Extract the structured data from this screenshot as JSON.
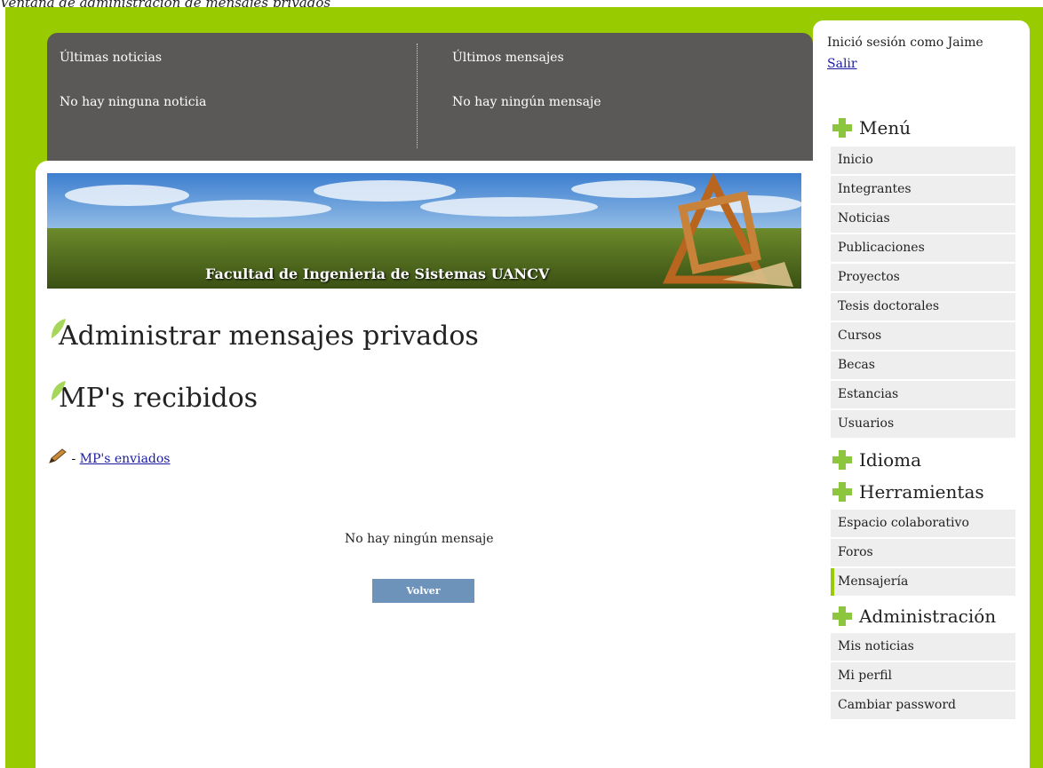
{
  "caption": "Ventana de administración de mensajes privados",
  "news": {
    "latest_news_title": "Últimas noticias",
    "latest_news_text": "No hay ninguna noticia",
    "latest_messages_title": "Últimos mensajes",
    "latest_messages_text": "No hay ningún mensaje"
  },
  "banner": {
    "title": "Facultad de Ingenieria de Sistemas UANCV"
  },
  "main": {
    "page_title": "Administrar mensajes privados",
    "section_title": "MP's recibidos",
    "sent_separator": "-",
    "sent_link": "MP's enviados",
    "empty_message": "No hay ningún mensaje",
    "back_button": "Volver"
  },
  "sidebar": {
    "login_text": "Inició sesión como Jaime",
    "logout_link": "Salir",
    "menu": {
      "title": "Menú",
      "items": [
        "Inicio",
        "Integrantes",
        "Noticias",
        "Publicaciones",
        "Proyectos",
        "Tesis doctorales",
        "Cursos",
        "Becas",
        "Estancias",
        "Usuarios"
      ]
    },
    "language": {
      "title": "Idioma"
    },
    "tools": {
      "title": "Herramientas",
      "items": [
        "Espacio colaborativo",
        "Foros",
        "Mensajería"
      ],
      "active": "Mensajería"
    },
    "admin": {
      "title": "Administración",
      "items": [
        "Mis noticias",
        "Mi perfil",
        "Cambiar password"
      ]
    }
  },
  "colors": {
    "frame_green": "#99cc00",
    "news_panel": "#5b5858",
    "menu_item_bg": "#eeeeee",
    "button_blue": "#6d93ba",
    "link_blue": "#1a1aa0"
  },
  "icons": [
    "leaf-icon",
    "pencil-icon",
    "plus-icon"
  ]
}
